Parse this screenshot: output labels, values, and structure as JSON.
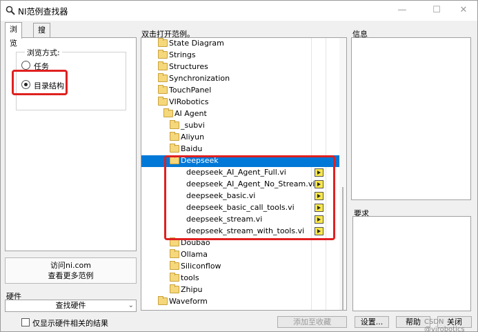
{
  "window": {
    "title": "NI范例查找器",
    "minimize": "—",
    "maximize": "☐",
    "close": "✕"
  },
  "tabs": [
    {
      "label": "浏览"
    },
    {
      "label": "搜索"
    }
  ],
  "browse": {
    "group_title": "浏览方式:",
    "options": [
      {
        "label": "任务",
        "selected": false
      },
      {
        "label": "目录结构",
        "selected": true
      }
    ]
  },
  "visit": {
    "line1": "访问ni.com",
    "line2": "查看更多范例"
  },
  "hardware": {
    "label": "硬件",
    "select_value": "查找硬件",
    "checkbox_label": "仅显示硬件相关的结果",
    "checked": false
  },
  "tree": {
    "header": "双击打开范例。",
    "rows": [
      {
        "label": "State Diagram",
        "type": "folder"
      },
      {
        "label": "Strings",
        "type": "folder"
      },
      {
        "label": "Structures",
        "type": "folder"
      },
      {
        "label": "Synchronization",
        "type": "folder"
      },
      {
        "label": "TouchPanel",
        "type": "folder"
      },
      {
        "label": "VIRobotics",
        "type": "folder"
      },
      {
        "label": "AI Agent",
        "type": "folder"
      },
      {
        "label": "_subvi",
        "type": "folder"
      },
      {
        "label": "Aliyun",
        "type": "folder"
      },
      {
        "label": "Baidu",
        "type": "folder"
      },
      {
        "label": "Deepseek",
        "type": "folder-open",
        "selected": true
      },
      {
        "label": "deepseek_AI_Agent_Full.vi",
        "type": "vi"
      },
      {
        "label": "deepseek_AI_Agent_No_Stream.vi",
        "type": "vi"
      },
      {
        "label": "deepseek_basic.vi",
        "type": "vi"
      },
      {
        "label": "deepseek_basic_call_tools.vi",
        "type": "vi"
      },
      {
        "label": "deepseek_stream.vi",
        "type": "vi"
      },
      {
        "label": "deepseek_stream_with_tools.vi",
        "type": "vi"
      },
      {
        "label": "Doubao",
        "type": "folder"
      },
      {
        "label": "Ollama",
        "type": "folder"
      },
      {
        "label": "Siliconflow",
        "type": "folder"
      },
      {
        "label": "tools",
        "type": "folder"
      },
      {
        "label": "Zhipu",
        "type": "folder"
      },
      {
        "label": "Waveform",
        "type": "folder"
      }
    ]
  },
  "info": {
    "label": "信息"
  },
  "requirements": {
    "label": "要求"
  },
  "buttons": {
    "add_favorite": "添加至收藏",
    "settings": "设置...",
    "help": "帮助",
    "close": "关闭"
  },
  "watermark": "CSDN @virobotics",
  "colors": {
    "selection": "#0078d7",
    "highlight_box": "#e02020",
    "folder": "#f5d77c",
    "vi_icon": "#f8e74a"
  }
}
